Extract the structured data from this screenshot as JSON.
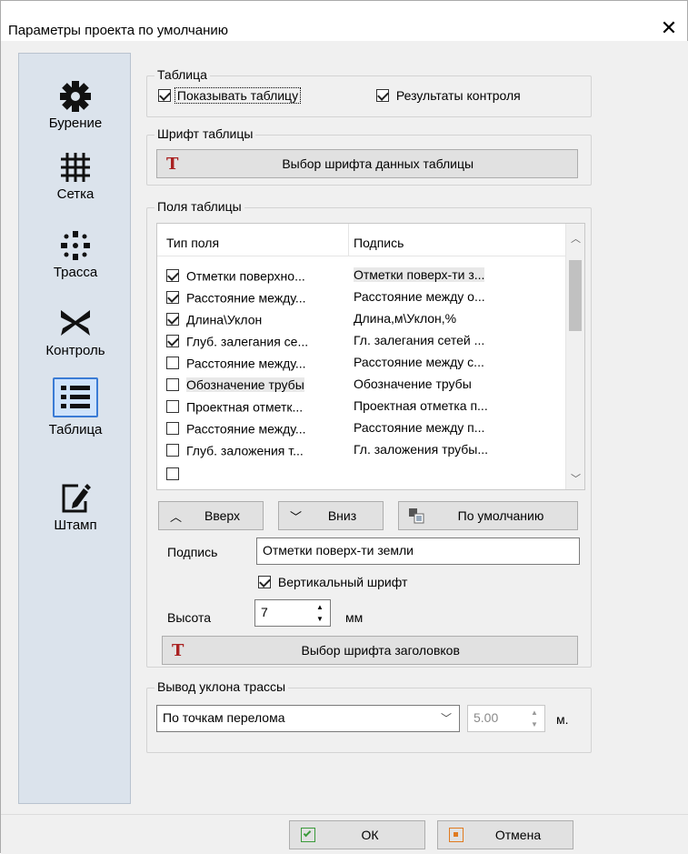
{
  "window": {
    "title": "Параметры проекта по умолчанию"
  },
  "sidebar": {
    "items": [
      {
        "label": "Бурение",
        "icon": "gear-icon"
      },
      {
        "label": "Сетка",
        "icon": "grid-icon"
      },
      {
        "label": "Трасса",
        "icon": "route-icon"
      },
      {
        "label": "Контроль",
        "icon": "control-icon"
      },
      {
        "label": "Таблица",
        "icon": "list-icon",
        "active": true
      },
      {
        "label": "Штамп",
        "icon": "stamp-edit-icon"
      }
    ]
  },
  "table_group": {
    "legend": "Таблица",
    "show_table": {
      "label": "Показывать таблицу",
      "checked": true
    },
    "results": {
      "label": "Результаты контроля",
      "checked": true
    }
  },
  "font_group": {
    "legend": "Шрифт таблицы",
    "button": "Выбор шрифта данных таблицы"
  },
  "fields_group": {
    "legend": "Поля таблицы",
    "columns": [
      "Тип поля",
      "Подпись"
    ],
    "rows": [
      {
        "type": "Отметки поверхно...",
        "caption": "Отметки поверх-ти з...",
        "checked": true
      },
      {
        "type": "Расстояние между...",
        "caption": "Расстояние между о...",
        "checked": true
      },
      {
        "type": "Длина\\Уклон",
        "caption": "Длина,м\\Уклон,%",
        "checked": true
      },
      {
        "type": "Глуб. залегания се...",
        "caption": "Гл. залегания сетей ...",
        "checked": true
      },
      {
        "type": "Расстояние между...",
        "caption": "Расстояние между с...",
        "checked": false
      },
      {
        "type": "Обозначение трубы",
        "caption": "Обозначение трубы",
        "checked": false
      },
      {
        "type": "Проектная отметк...",
        "caption": "Проектная отметка п...",
        "checked": false
      },
      {
        "type": "Расстояние между...",
        "caption": "Расстояние между п...",
        "checked": false
      },
      {
        "type": "Глуб. заложения т...",
        "caption": "Гл. заложения трубы...",
        "checked": false
      }
    ],
    "up_button": "Вверх",
    "down_button": "Вниз",
    "default_button": "По умолчанию",
    "caption_label": "Подпись",
    "caption_value": "Отметки поверх-ти земли",
    "vertical_font": {
      "label": "Вертикальный шрифт",
      "checked": true
    },
    "height_label": "Высота",
    "height_value": "7",
    "height_unit": "мм",
    "header_font_button": "Выбор шрифта заголовков"
  },
  "slope_group": {
    "legend": "Вывод уклона трассы",
    "mode_value": "По точкам перелома",
    "slope_value": "5.00",
    "slope_unit": "м."
  },
  "footer": {
    "ok": "ОК",
    "cancel": "Отмена"
  }
}
